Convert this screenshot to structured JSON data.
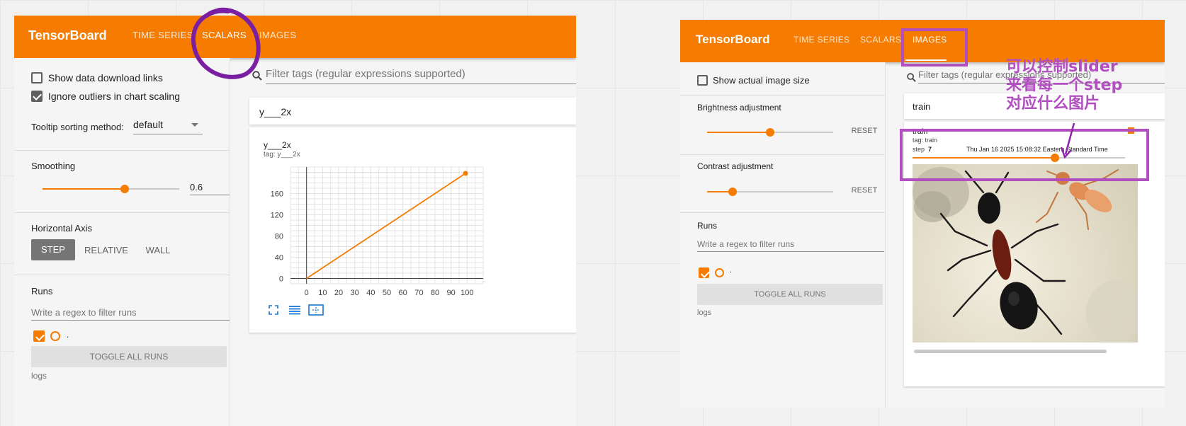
{
  "left": {
    "brand": "TensorBoard",
    "tabs": [
      "TIME SERIES",
      "SCALARS",
      "IMAGES"
    ],
    "active_tab": "SCALARS",
    "options": {
      "show_download": "Show data download links",
      "ignore_outliers": "Ignore outliers in chart scaling",
      "tooltip_label": "Tooltip sorting method:",
      "tooltip_value": "default"
    },
    "smoothing": {
      "label": "Smoothing",
      "value": "0.6",
      "fraction": 0.6
    },
    "horizontal_axis": {
      "label": "Horizontal Axis",
      "options": [
        "STEP",
        "RELATIVE",
        "WALL"
      ],
      "selected": "STEP"
    },
    "runs": {
      "label": "Runs",
      "filter_placeholder": "Write a regex to filter runs",
      "run_name": ".",
      "toggle": "TOGGLE ALL RUNS",
      "logdir": "logs"
    },
    "filter_placeholder": "Filter tags (regular expressions supported)",
    "group_title": "y___2x",
    "chart": {
      "title": "y___2x",
      "tag": "tag: y___2x"
    }
  },
  "chart_data": {
    "type": "line",
    "title": "y___2x",
    "series": [
      {
        "x": [
          0,
          10,
          20,
          30,
          40,
          50,
          60,
          70,
          80,
          90,
          99
        ],
        "y": [
          0,
          20,
          40,
          60,
          80,
          100,
          120,
          140,
          160,
          180,
          198
        ]
      }
    ],
    "xlim": [
      -10,
      110
    ],
    "ylim": [
      -10,
      210
    ],
    "xticks": [
      0,
      10,
      20,
      30,
      40,
      50,
      60,
      70,
      80,
      90,
      100
    ],
    "yticks": [
      0,
      40,
      80,
      120,
      160
    ],
    "grid": true,
    "color": "#f57c00"
  },
  "right": {
    "brand": "TensorBoard",
    "tabs": [
      "TIME SERIES",
      "SCALARS",
      "IMAGES"
    ],
    "active_tab": "IMAGES",
    "show_actual": "Show actual image size",
    "brightness": {
      "label": "Brightness adjustment",
      "reset": "RESET",
      "fraction": 0.5
    },
    "contrast": {
      "label": "Contrast adjustment",
      "reset": "RESET",
      "fraction": 0.2
    },
    "runs": {
      "label": "Runs",
      "filter_placeholder": "Write a regex to filter runs",
      "run_name": ".",
      "toggle": "TOGGLE ALL RUNS",
      "logdir": "logs"
    },
    "filter_placeholder": "Filter tags (regular expressions supported)",
    "group_title": "train",
    "image_card": {
      "title": "train",
      "tag": "tag: train",
      "step_label": "step",
      "step_value": "7",
      "timestamp": "Thu Jan 16 2025 15:08:32 Eastern Standard Time",
      "step_fraction": 0.67
    }
  },
  "annotation": [
    "可以控制slider",
    "来看每一个step",
    "对应什么图片"
  ],
  "colors": {
    "accent": "#f57c00",
    "annotation": "#b14fc0"
  }
}
